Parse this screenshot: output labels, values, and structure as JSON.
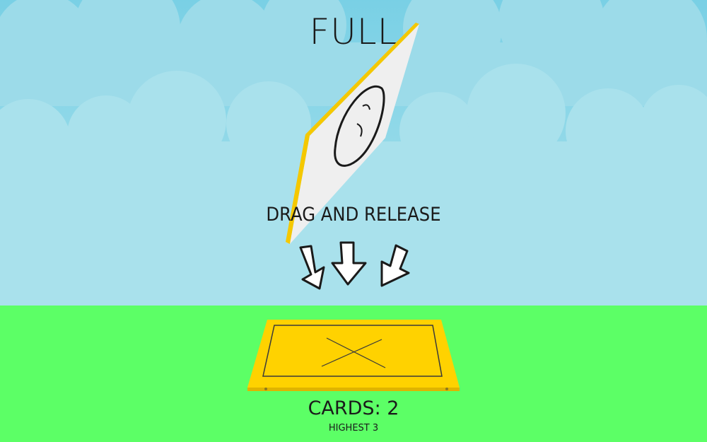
{
  "game": {
    "title": "FULL",
    "instruction": "DRAG AND RELEASE",
    "cards_label": "CARDS: 2",
    "highest_label": "HIGHEST 3"
  },
  "colors": {
    "sky_light": "#aee3ec",
    "sky_dark": "#7fd3e6",
    "cloud": "#9bdbe9",
    "ground": "#5cff66",
    "card_face": "#efefef",
    "card_edge": "#f5c800",
    "target_pad": "#ffd200",
    "target_shadow": "#e0b400",
    "ink": "#1a1a1a"
  },
  "icons": {
    "card_symbol": "smiley-icon",
    "arrows": [
      "arrow-down-left-icon",
      "arrow-down-icon",
      "arrow-down-right-icon"
    ],
    "target": "x-mark-icon"
  }
}
